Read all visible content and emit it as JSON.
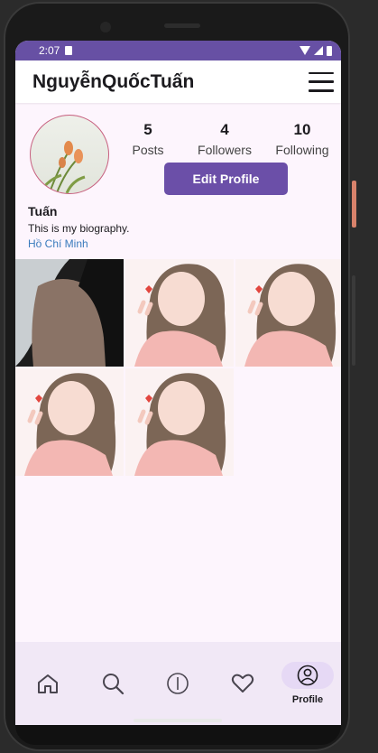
{
  "status_bar": {
    "time": "2:07"
  },
  "app_bar": {
    "title": "NguyễnQuốcTuấn",
    "menu_icon": "hamburger-menu-icon"
  },
  "profile": {
    "stats": [
      {
        "value": "5",
        "label": "Posts"
      },
      {
        "value": "4",
        "label": "Followers"
      },
      {
        "value": "10",
        "label": "Following"
      }
    ],
    "edit_button": "Edit Profile",
    "name": "Tuấn",
    "biography": "This is my biography.",
    "location": "Hồ Chí Minh"
  },
  "colors": {
    "primary": "#6750a4",
    "button": "#6b4fa8",
    "link": "#3a7bbd",
    "background": "#fdf5fd",
    "nav_background": "#f1e8f6"
  },
  "bottom_nav": {
    "items": [
      {
        "icon": "home-icon",
        "label": ""
      },
      {
        "icon": "search-icon",
        "label": ""
      },
      {
        "icon": "add-post-icon",
        "label": ""
      },
      {
        "icon": "heart-icon",
        "label": ""
      },
      {
        "icon": "profile-icon",
        "label": "Profile"
      }
    ]
  }
}
